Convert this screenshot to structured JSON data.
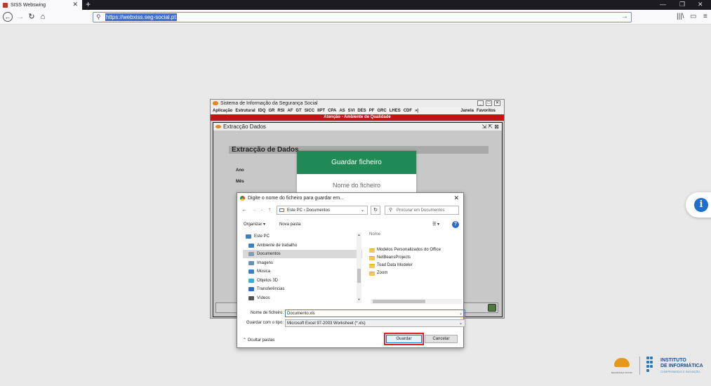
{
  "browser": {
    "tab_title": "SISS Webswing",
    "url": "https://webxiss.seg-social.pt",
    "icons": [
      "back-icon",
      "forward-icon",
      "reload-icon",
      "home-icon",
      "search-icon",
      "go-arrow-icon",
      "library-icon",
      "sidebar-icon",
      "menu-icon"
    ]
  },
  "app": {
    "title": "Sistema de Informação da Segurança Social",
    "menu": [
      "Aplicação",
      "Estrutural",
      "IDQ",
      "GR",
      "RSI",
      "AF",
      "GT",
      "SICC",
      "IIPT",
      "CPA",
      "AS",
      "SVI",
      "DES",
      "PF",
      "GRC",
      "LHES",
      "CDF",
      "»|"
    ],
    "menu_right": [
      "Janela",
      "Favoritos"
    ],
    "alert": "Atenção - Ambiente de Qualidade",
    "inner_title": "Extracção Dados",
    "section_title": "Extracção de Dados",
    "field_labels": [
      "Ano",
      "Mês"
    ]
  },
  "guardar_modal": {
    "title": "Guardar ficheiro",
    "field_placeholder": "Nome do ficheiro"
  },
  "file_dialog": {
    "title": "Digite o nome do ficheiro para guardar em...",
    "path": [
      "Este PC",
      "Documentos"
    ],
    "search_placeholder": "Procurar em Documentos",
    "organize_label": "Organizar ▾",
    "new_folder_label": "Nova pasta",
    "nav_items": [
      {
        "label": "Este PC",
        "icon": "pc-icon",
        "color": "#3c7fc4"
      },
      {
        "label": "Ambiente de trabalho",
        "icon": "desktop-icon",
        "color": "#3c7fc4"
      },
      {
        "label": "Documentos",
        "icon": "documents-icon",
        "color": "#8a9bb0",
        "selected": true
      },
      {
        "label": "Imagens",
        "icon": "images-icon",
        "color": "#6a8fb5"
      },
      {
        "label": "Música",
        "icon": "music-icon",
        "color": "#3c7fc4"
      },
      {
        "label": "Objetos 3D",
        "icon": "3d-objects-icon",
        "color": "#3cb0d0"
      },
      {
        "label": "Transferências",
        "icon": "download-icon",
        "color": "#2c6ac4"
      },
      {
        "label": "Vídeos",
        "icon": "videos-icon",
        "color": "#555"
      }
    ],
    "column_header": "Nome",
    "files": [
      "Modelos Personalizados do Office",
      "NetBeansProjects",
      "Toad Data Modeler",
      "Zoom"
    ],
    "filename_label": "Nome de ficheiro:",
    "filename_value": "Documento.xls",
    "type_label": "Guardar com o tipo:",
    "type_value": "Microsoft Excel 97-2003 Worksheet (*.xls)",
    "hide_folders_label": "Ocultar pastas",
    "save_label": "Guardar",
    "cancel_label": "Cancelar"
  },
  "footer": {
    "ss_label": "SEGURANÇA SOCIAL",
    "ii_line1": "INSTITUTO",
    "ii_line2": "DE INFORMÁTICA",
    "ii_line3": "COMPROMISSO E INOVAÇÃO"
  },
  "colors": {
    "modal_header": "#1f8a55",
    "alert_bar": "#c11515",
    "save_highlight": "#e0201e"
  }
}
